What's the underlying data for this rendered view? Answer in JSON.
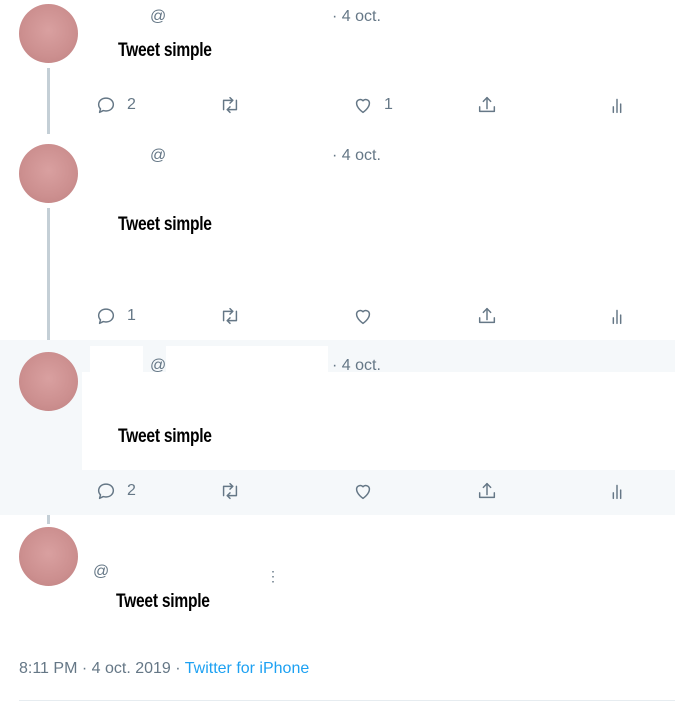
{
  "tweets": [
    {
      "handle": "@",
      "date": "· 4 oct.",
      "text": "Tweet simple",
      "reply_count": "2",
      "like_count": "1"
    },
    {
      "handle": "@",
      "date": "· 4 oct.",
      "text": "Tweet simple",
      "reply_count": "1",
      "like_count": ""
    },
    {
      "handle": "@",
      "date": "· 4 oct.",
      "text": "Tweet simple",
      "reply_count": "2",
      "like_count": ""
    }
  ],
  "main_tweet": {
    "handle": "@",
    "more": "⋮",
    "text": "Tweet simple"
  },
  "meta": {
    "time": "8:11 PM",
    "date": "4 oct. 2019",
    "separator": "·",
    "source": "Twitter for iPhone"
  },
  "icons": [
    "reply-icon",
    "retweet-icon",
    "like-icon",
    "share-icon",
    "analytics-icon"
  ]
}
